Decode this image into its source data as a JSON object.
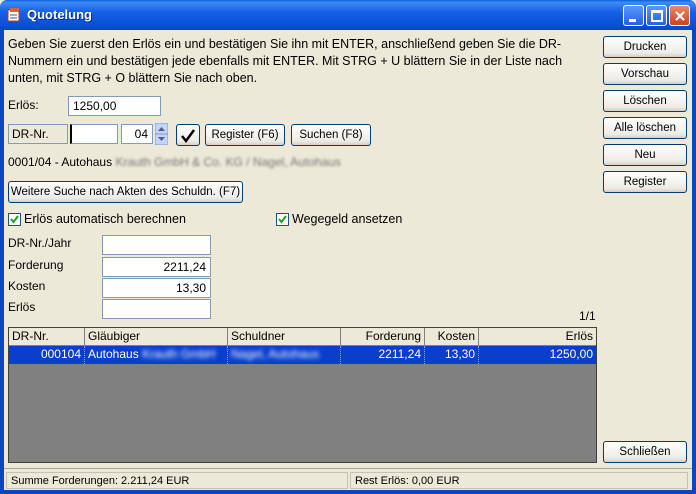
{
  "window": {
    "title": "Quotelung"
  },
  "instructions": "Geben Sie zuerst den Erlös ein und bestätigen Sie ihn mit ENTER, anschließend geben Sie die DR-Nummern ein und bestätigen jede ebenfalls mit ENTER. Mit STRG + U blättern Sie in der Liste nach unten, mit STRG + O blättern Sie nach oben.",
  "erloes": {
    "label": "Erlös:",
    "value": "1250,00"
  },
  "dr": {
    "label": "DR-Nr.",
    "number": "",
    "year": "04"
  },
  "buttons": {
    "register_f6": "Register (F6)",
    "suchen_f8": "Suchen (F8)",
    "weitere_suche": "Weitere Suche nach Akten des Schuldn. (F7)"
  },
  "result_line": {
    "prefix": "0001/04 - Autohaus",
    "rest": "Krauth GmbH & Co. KG / Nagel, Autohaus"
  },
  "options": {
    "auto_calc": {
      "label": "Erlös automatisch berechnen",
      "checked": true
    },
    "wegegeld": {
      "label": "Wegegeld ansetzen",
      "checked": true
    }
  },
  "fields": {
    "dr_jahr": {
      "label": "DR-Nr./Jahr",
      "value": ""
    },
    "forderung": {
      "label": "Forderung",
      "value": "2211,24"
    },
    "kosten": {
      "label": "Kosten",
      "value": "13,30"
    },
    "erloes2": {
      "label": "Erlös",
      "value": ""
    }
  },
  "page_indicator": "1/1",
  "table": {
    "columns": [
      "DR-Nr.",
      "Gläubiger",
      "Schuldner",
      "Forderung",
      "Kosten",
      "Erlös"
    ],
    "rows": [
      {
        "dr": "000104",
        "glaeubiger": "Autohaus",
        "glaeubiger_hidden": "Krauth GmbH",
        "schuldner_hidden": "Nagel, Autohaus",
        "forderung": "2211,24",
        "kosten": "13,30",
        "erloes": "1250,00"
      }
    ]
  },
  "side_buttons": [
    "Drucken",
    "Vorschau",
    "Löschen",
    "Alle löschen",
    "Neu",
    "Register"
  ],
  "close_button": "Schließen",
  "status": {
    "summe": "Summe Forderungen: 2.211,24 EUR",
    "rest": "Rest Erlös: 0,00 EUR"
  }
}
